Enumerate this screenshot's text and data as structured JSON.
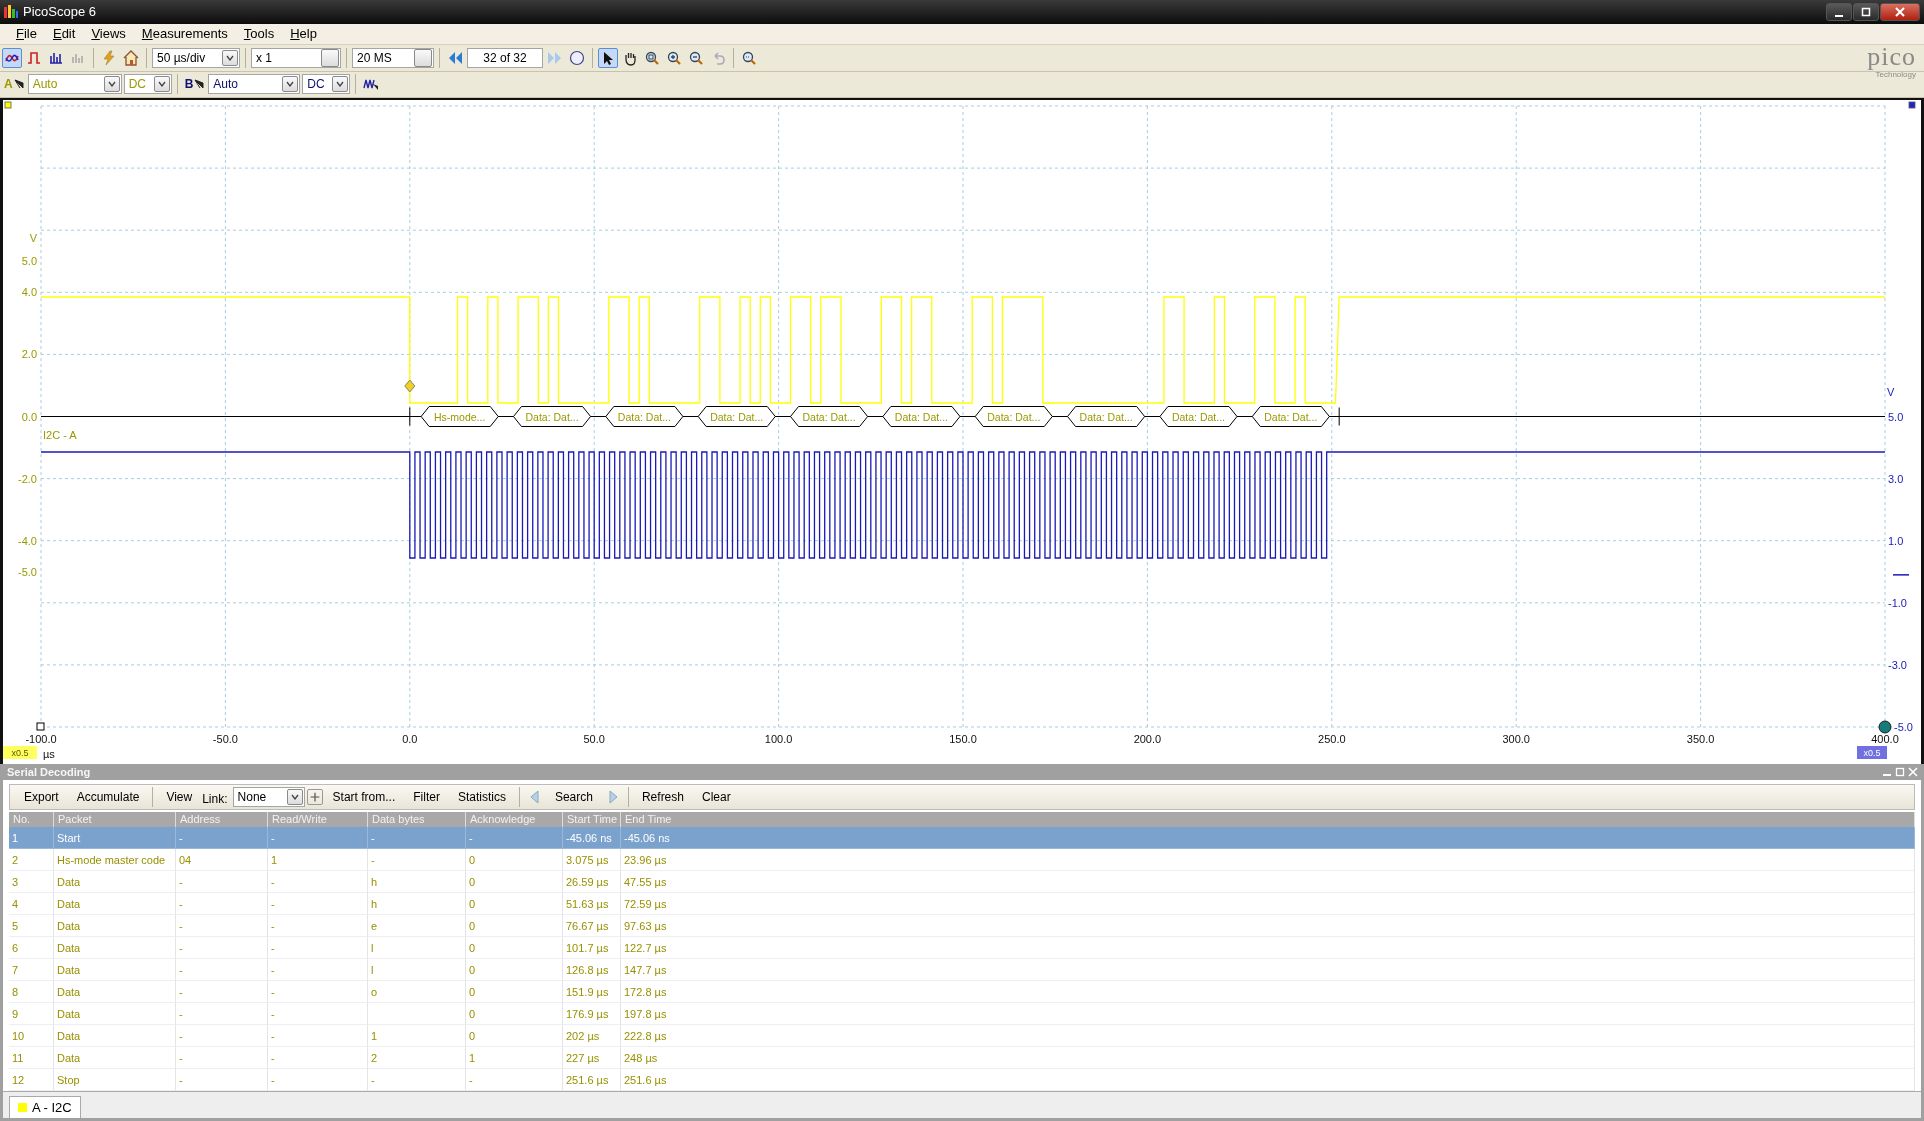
{
  "window": {
    "title": "PicoScope 6"
  },
  "menu": [
    "File",
    "Edit",
    "Views",
    "Measurements",
    "Tools",
    "Help"
  ],
  "modes": [
    {
      "kind": "scope",
      "selected": true
    },
    {
      "kind": "persistence",
      "selected": false
    },
    {
      "kind": "spectrum",
      "selected": false
    },
    {
      "kind": "measure",
      "selected": false
    }
  ],
  "toolbar": {
    "timebase": "50 µs/div",
    "zoom": "x 1",
    "samples": "20 MS",
    "buffer": "32 of 32"
  },
  "tools": [
    {
      "kind": "pointer",
      "selected": true
    },
    {
      "kind": "hand",
      "selected": false
    },
    {
      "kind": "zoom-box",
      "selected": false
    },
    {
      "kind": "zoom-in",
      "selected": false
    },
    {
      "kind": "zoom-out",
      "selected": false
    },
    {
      "kind": "undo",
      "selected": false
    }
  ],
  "logo": {
    "name": "pico",
    "tagline": "Technology"
  },
  "channels": [
    {
      "name": "A",
      "range": "Auto",
      "coupling": "DC",
      "color": "#ffff00"
    },
    {
      "name": "B",
      "range": "Auto",
      "coupling": "DC",
      "color": "#1a1ab8"
    }
  ],
  "scope": {
    "axis_a": {
      "unit": "V",
      "ticks": [
        "5.0",
        "4.0",
        "2.0",
        "0.0",
        "-2.0",
        "-4.0",
        "-5.0"
      ]
    },
    "axis_b": {
      "unit": "V",
      "ticks": [
        "5.0",
        "3.0",
        "1.0",
        "-1.0",
        "-3.0",
        "-5.0"
      ]
    },
    "x_ticks": [
      "-100.0",
      "-50.0",
      "0.0",
      "50.0",
      "100.0",
      "150.0",
      "200.0",
      "250.0",
      "300.0",
      "350.0",
      "400.0"
    ],
    "x_unit": "µs",
    "scale_a": "x0.5",
    "scale_b": "x0.5",
    "trace_label": "I2C - A",
    "decode_packets": [
      "Hs-mode...",
      "Data: Dat...",
      "Data: Dat...",
      "Data: Dat...",
      "Data: Dat...",
      "Data: Dat...",
      "Data: Dat...",
      "Data: Dat...",
      "Data: Dat...",
      "Data: Dat..."
    ]
  },
  "serial_decoding": {
    "title": "Serial Decoding",
    "buttons_left": [
      "Export",
      "Accumulate",
      "View"
    ],
    "link_label": "Link:",
    "link_value": "None",
    "buttons_mid": [
      "Start from...",
      "Filter",
      "Statistics"
    ],
    "search": "Search",
    "buttons_right": [
      "Refresh",
      "Clear"
    ],
    "columns": [
      "No.",
      "Packet",
      "Address",
      "Read/Write",
      "Data bytes",
      "Acknowledge",
      "Start Time",
      "End Time"
    ],
    "rows": [
      {
        "selected": true,
        "no": "1",
        "packet": "Start",
        "address": "-",
        "read_write": "-",
        "data_bytes": "-",
        "acknowledge": "-",
        "start_time": "-45.06 ns",
        "end_time": "-45.06 ns"
      },
      {
        "selected": false,
        "no": "2",
        "packet": "Hs-mode master code",
        "address": "04",
        "read_write": "1",
        "data_bytes": "-",
        "acknowledge": "0",
        "start_time": "3.075 µs",
        "end_time": "23.96 µs"
      },
      {
        "selected": false,
        "no": "3",
        "packet": "Data",
        "address": "-",
        "read_write": "-",
        "data_bytes": "h",
        "acknowledge": "0",
        "start_time": "26.59 µs",
        "end_time": "47.55 µs"
      },
      {
        "selected": false,
        "no": "4",
        "packet": "Data",
        "address": "-",
        "read_write": "-",
        "data_bytes": "h",
        "acknowledge": "0",
        "start_time": "51.63 µs",
        "end_time": "72.59 µs"
      },
      {
        "selected": false,
        "no": "5",
        "packet": "Data",
        "address": "-",
        "read_write": "-",
        "data_bytes": "e",
        "acknowledge": "0",
        "start_time": "76.67 µs",
        "end_time": "97.63 µs"
      },
      {
        "selected": false,
        "no": "6",
        "packet": "Data",
        "address": "-",
        "read_write": "-",
        "data_bytes": "l",
        "acknowledge": "0",
        "start_time": "101.7 µs",
        "end_time": "122.7 µs"
      },
      {
        "selected": false,
        "no": "7",
        "packet": "Data",
        "address": "-",
        "read_write": "-",
        "data_bytes": "l",
        "acknowledge": "0",
        "start_time": "126.8 µs",
        "end_time": "147.7 µs"
      },
      {
        "selected": false,
        "no": "8",
        "packet": "Data",
        "address": "-",
        "read_write": "-",
        "data_bytes": "o",
        "acknowledge": "0",
        "start_time": "151.9 µs",
        "end_time": "172.8 µs"
      },
      {
        "selected": false,
        "no": "9",
        "packet": "Data",
        "address": "-",
        "read_write": "-",
        "acknowledge": "0",
        "start_time": "176.9 µs",
        "end_time": "197.8 µs"
      },
      {
        "selected": false,
        "no": "10",
        "packet": "Data",
        "address": "-",
        "read_write": "-",
        "data_bytes": "1",
        "acknowledge": "0",
        "start_time": "202 µs",
        "end_time": "222.8 µs"
      },
      {
        "selected": false,
        "no": "11",
        "packet": "Data",
        "address": "-",
        "read_write": "-",
        "data_bytes": "2",
        "acknowledge": "1",
        "start_time": "227 µs",
        "end_time": "248 µs"
      },
      {
        "selected": false,
        "no": "12",
        "packet": "Stop",
        "address": "-",
        "read_write": "-",
        "data_bytes": "-",
        "acknowledge": "-",
        "start_time": "251.6 µs",
        "end_time": "251.6 µs"
      }
    ],
    "tabs": [
      {
        "label": "A - I2C",
        "selected": true
      }
    ]
  }
}
